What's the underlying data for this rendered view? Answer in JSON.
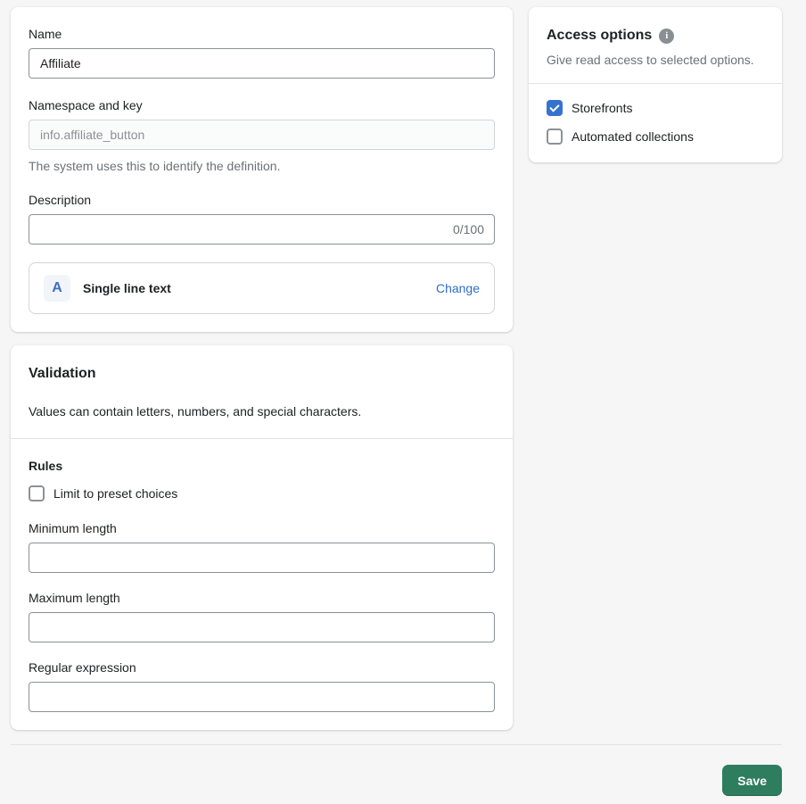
{
  "definition_card": {
    "name_label": "Name",
    "name_value": "Affiliate",
    "namespace_label": "Namespace and key",
    "namespace_value": "info.affiliate_button",
    "namespace_help": "The system uses this to identify the definition.",
    "description_label": "Description",
    "description_value": "",
    "description_counter": "0/100",
    "type": {
      "icon_letter": "A",
      "label": "Single line text",
      "change_label": "Change"
    }
  },
  "validation_card": {
    "title": "Validation",
    "subtitle": "Values can contain letters, numbers, and special characters.",
    "rules_label": "Rules",
    "limit_checkbox": {
      "label": "Limit to preset choices",
      "checked": false
    },
    "fields": [
      {
        "label": "Minimum length",
        "value": ""
      },
      {
        "label": "Maximum length",
        "value": ""
      },
      {
        "label": "Regular expression",
        "value": ""
      }
    ]
  },
  "access_card": {
    "title": "Access options",
    "subtitle": "Give read access to selected options.",
    "options": [
      {
        "label": "Storefronts",
        "checked": true
      },
      {
        "label": "Automated collections",
        "checked": false
      }
    ]
  },
  "footer": {
    "save_label": "Save"
  },
  "colors": {
    "accent_blue": "#2c6ecb",
    "checkbox_blue": "#3672cf",
    "save_green": "#2e7d5e",
    "text_primary": "#202223",
    "text_subdued": "#6d7175",
    "page_background": "#f6f6f7"
  }
}
